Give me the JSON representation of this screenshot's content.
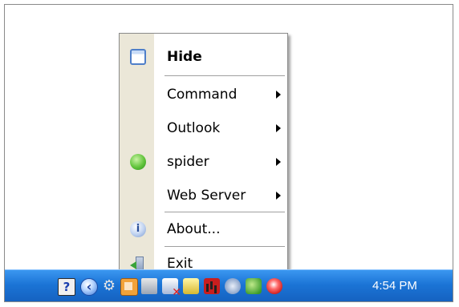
{
  "menu": {
    "items": [
      {
        "label": "Hide",
        "icon": "window-icon",
        "submenu": false,
        "bold": true
      },
      {
        "label": "Command",
        "icon": "",
        "submenu": true
      },
      {
        "label": "Outlook",
        "icon": "",
        "submenu": true
      },
      {
        "label": "spider",
        "icon": "green-status-icon",
        "submenu": true
      },
      {
        "label": "Web Server",
        "icon": "",
        "submenu": true
      },
      {
        "label": "About...",
        "icon": "info-icon",
        "submenu": false
      },
      {
        "label": "Exit",
        "icon": "exit-icon",
        "submenu": false
      }
    ]
  },
  "taskbar": {
    "clock": "4:54 PM",
    "tray_icons": [
      "help-icon",
      "back-arrow-icon",
      "gear-icon",
      "java-icon",
      "speaker-icon",
      "network-disconnected-icon",
      "drive-icon",
      "chart-icon",
      "printer-icon",
      "shield-green-icon",
      "security-alert-icon"
    ]
  },
  "colors": {
    "taskbar_blue": "#1b74d6",
    "menu_sidebar": "#ebe7d8",
    "status_green": "#61c43b"
  }
}
